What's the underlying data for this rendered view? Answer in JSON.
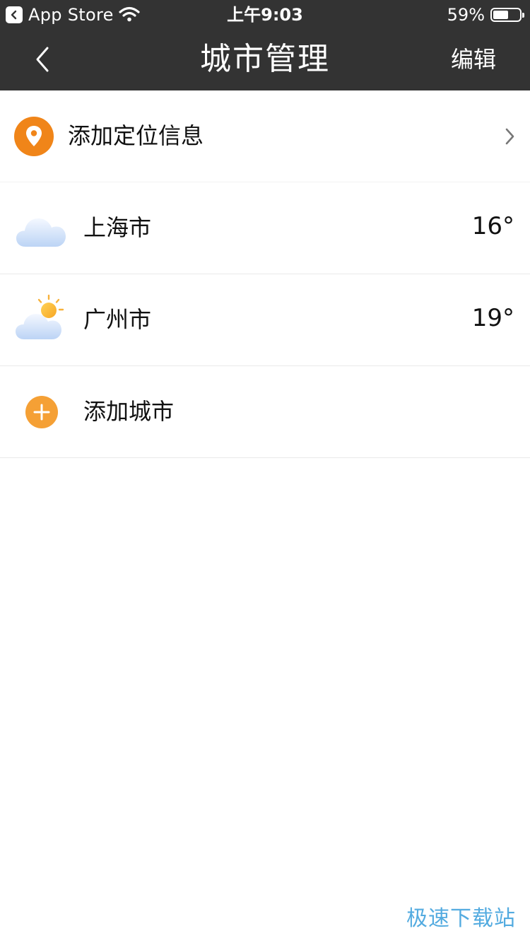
{
  "status_bar": {
    "back_app": "App Store",
    "time": "上午9:03",
    "battery_percent": "59%",
    "battery_level": 0.59
  },
  "nav": {
    "title": "城市管理",
    "edit": "编辑"
  },
  "location_row": {
    "label": "添加定位信息",
    "icon": "location-pin-icon"
  },
  "cities": [
    {
      "name": "上海市",
      "temp": "16°",
      "icon": "cloudy-icon"
    },
    {
      "name": "广州市",
      "temp": "19°",
      "icon": "partly-sunny-icon"
    }
  ],
  "add_city": {
    "label": "添加城市",
    "icon": "plus-icon"
  },
  "watermark": "极速下载站",
  "colors": {
    "header_bg": "#333333",
    "accent_orange": "#f08519",
    "add_orange": "#f5a035",
    "divider": "#e9e9e9"
  }
}
